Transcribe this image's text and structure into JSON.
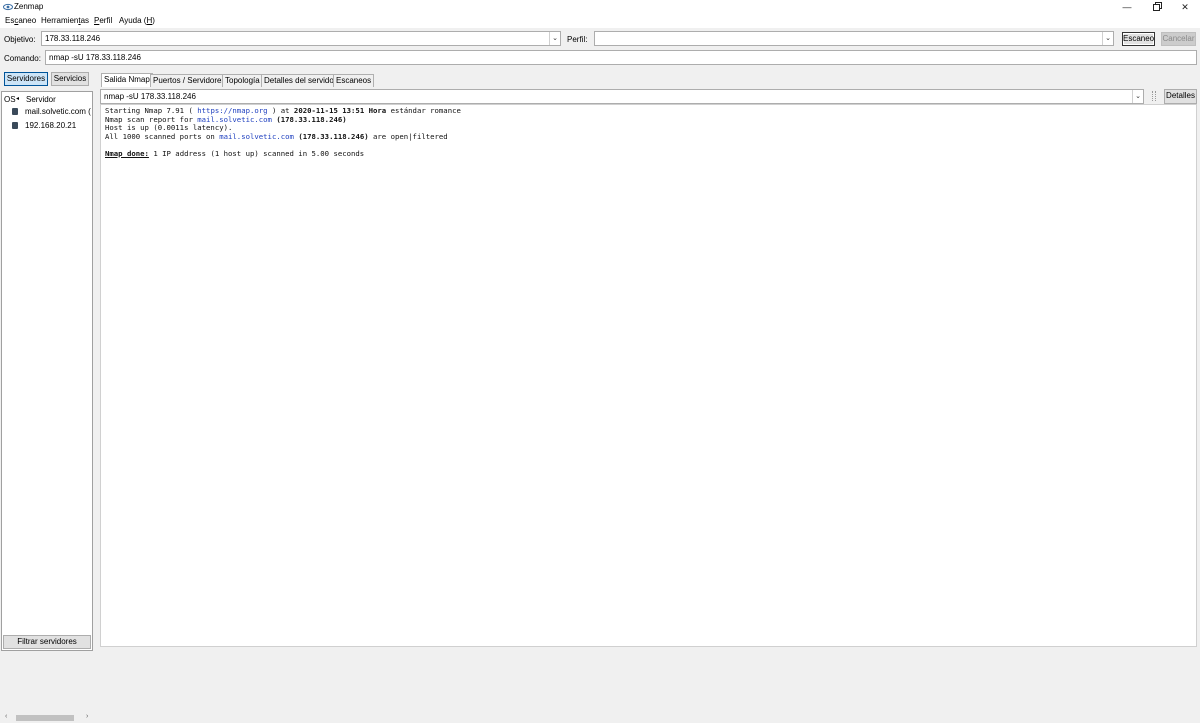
{
  "window": {
    "title": "Zenmap"
  },
  "menu": {
    "items": [
      {
        "pre": "Es",
        "u": "c",
        "post": "aneo"
      },
      {
        "pre": "Herramien",
        "u": "t",
        "post": "as"
      },
      {
        "pre": "",
        "u": "P",
        "post": "erfil"
      },
      {
        "pre": "Ayuda (",
        "u": "H",
        "post": ")"
      }
    ]
  },
  "toolbar": {
    "target_label": "Objetivo:",
    "target_value": "178.33.118.246",
    "profile_label": "Perfil:",
    "profile_value": "",
    "scan_button": "Escaneo",
    "cancel_button": "Cancelar",
    "command_label": "Comando:",
    "command_value": "nmap -sU 178.33.118.246"
  },
  "left_panel": {
    "hosts_toggle": "Servidores",
    "services_toggle": "Servicios",
    "col_os": "OS",
    "col_host": "Servidor",
    "hosts": [
      "mail.solvetic.com (",
      "192.168.20.21"
    ],
    "filter_button": "Filtrar servidores"
  },
  "tabs": [
    "Salida Nmap",
    "Puertos / Servidores",
    "Topología",
    "Detalles del servidor",
    "Escaneos"
  ],
  "output_bar": {
    "selected": "nmap -sU 178.33.118.246",
    "details_button": "Detalles"
  },
  "output": {
    "l1_a": "Starting Nmap 7.91 ( ",
    "l1_link": "https://nmap.org",
    "l1_b": " ) at ",
    "l1_date": "2020-11-15 13:51 Hora",
    "l1_c": " estándar romance",
    "l2_a": "Nmap scan report for ",
    "l2_link": "mail.solvetic.com",
    "l2_b": " ",
    "l2_ip": "(178.33.118.246)",
    "l3": "Host is up (0.0011s latency).",
    "l4_a": "All 1000 scanned ports on ",
    "l4_link": "mail.solvetic.com",
    "l4_b": " ",
    "l4_ip": "(178.33.118.246)",
    "l4_c": " are open|filtered",
    "l5_done": "Nmap done:",
    "l5_rest": " 1 IP address (1 host up) scanned in 5.00 seconds"
  },
  "colors": {
    "link": "#1e3fbf",
    "active_toggle": "#cce4f7",
    "accent_border": "#005499"
  }
}
